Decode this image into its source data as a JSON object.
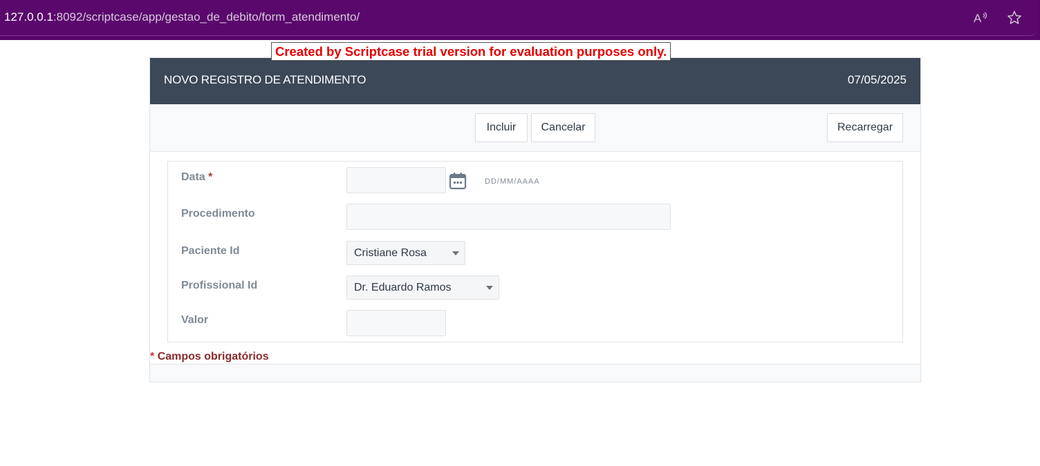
{
  "browser": {
    "url_host": "127.0.0.1",
    "url_rest": ":8092/scriptcase/app/gestao_de_debito/form_atendimento/",
    "icons": [
      "read-aloud-icon",
      "favorite-star-icon"
    ]
  },
  "trial_banner": "Created by Scriptcase trial version for evaluation purposes only.",
  "form": {
    "title": "NOVO REGISTRO DE ATENDIMENTO",
    "date": "07/05/2025",
    "toolbar": {
      "incluir": "Incluir",
      "cancelar": "Cancelar",
      "recarregar": "Recarregar"
    },
    "fields": {
      "data": {
        "label": "Data",
        "required_mark": "*",
        "value": "",
        "format_hint": "DD/MM/AAAA"
      },
      "procedimento": {
        "label": "Procedimento",
        "value": ""
      },
      "paciente": {
        "label": "Paciente Id",
        "selected": "Cristiane Rosa"
      },
      "profissional": {
        "label": "Profissional Id",
        "selected": "Dr. Eduardo Ramos"
      },
      "valor": {
        "label": "Valor",
        "value": ""
      }
    },
    "required_note_mark": "*",
    "required_note": "Campos obrigatórios"
  },
  "colors": {
    "addressbar": "#5a086c",
    "header": "#3c4858",
    "banner_text": "#e60000",
    "required": "#8b2a2a"
  }
}
